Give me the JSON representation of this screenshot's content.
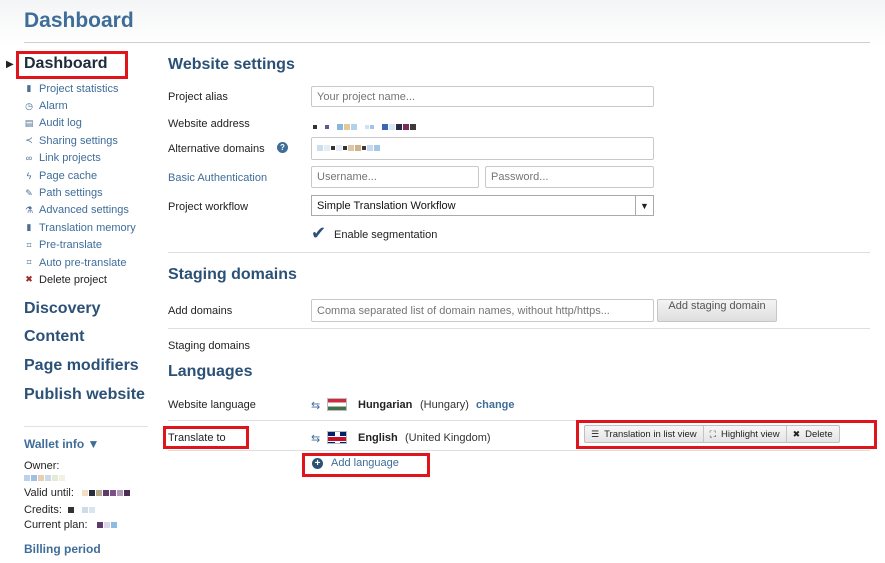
{
  "header": {
    "title": "Dashboard"
  },
  "sidebar": {
    "active_item": "Dashboard",
    "items": [
      {
        "label": "Project statistics",
        "icon": "bar-chart-icon"
      },
      {
        "label": "Alarm",
        "icon": "clock-icon"
      },
      {
        "label": "Audit log",
        "icon": "document-icon"
      },
      {
        "label": "Sharing settings",
        "icon": "share-icon"
      },
      {
        "label": "Link projects",
        "icon": "link-icon"
      },
      {
        "label": "Page cache",
        "icon": "lightning-icon"
      },
      {
        "label": "Path settings",
        "icon": "edit-icon"
      },
      {
        "label": "Advanced settings",
        "icon": "flask-icon"
      },
      {
        "label": "Translation memory",
        "icon": "memory-icon"
      },
      {
        "label": "Pre-translate",
        "icon": "translate-icon"
      },
      {
        "label": "Auto pre-translate",
        "icon": "translate-icon"
      },
      {
        "label": "Delete project",
        "icon": "delete-icon"
      }
    ],
    "sections": [
      "Discovery",
      "Content",
      "Page modifiers",
      "Publish website"
    ],
    "wallet": {
      "title": "Wallet info ▼",
      "owner_label": "Owner:",
      "valid_until_label": "Valid until:",
      "credits_label": "Credits:",
      "current_plan_label": "Current plan:",
      "billing_period": "Billing period"
    }
  },
  "website_settings": {
    "title": "Website settings",
    "project_alias_label": "Project alias",
    "project_alias_placeholder": "Your project name...",
    "website_address_label": "Website address",
    "alternative_domains_label": "Alternative domains",
    "basic_auth_label": "Basic Authentication",
    "username_placeholder": "Username...",
    "password_placeholder": "Password...",
    "workflow_label": "Project workflow",
    "workflow_value": "Simple Translation Workflow",
    "segmentation_label": "Enable segmentation"
  },
  "staging": {
    "title": "Staging domains",
    "add_domains_label": "Add domains",
    "add_domains_placeholder": "Comma separated list of domain names, without http/https...",
    "add_button": "Add staging domain",
    "staging_domains_label": "Staging domains"
  },
  "languages": {
    "title": "Languages",
    "website_language_label": "Website language",
    "website_language_name": "Hungarian",
    "website_language_region": "(Hungary)",
    "change_link": "change",
    "translate_to_label": "Translate to",
    "target_language_name": "English",
    "target_language_region": "(United Kingdom)",
    "actions": {
      "list_view": "Translation in list view",
      "highlight_view": "Highlight view",
      "delete": "Delete"
    },
    "add_language": "Add language"
  },
  "colors": {
    "accent": "#3f6d99",
    "heading": "#2c5177",
    "highlight_box": "#e0141b"
  }
}
